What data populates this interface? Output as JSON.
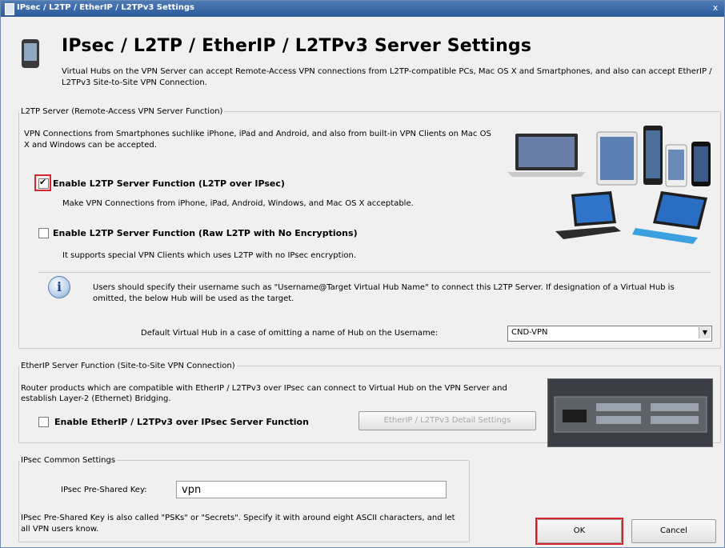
{
  "window": {
    "title": "IPsec / L2TP / EtherIP / L2TPv3 Settings",
    "close_glyph": "x"
  },
  "header": {
    "title": "IPsec / L2TP / EtherIP / L2TPv3 Server Settings",
    "description": "Virtual Hubs on the VPN Server can accept Remote-Access VPN connections from L2TP-compatible PCs, Mac OS X and Smartphones, and also can accept EtherIP / L2TPv3 Site-to-Site VPN Connection."
  },
  "l2tp": {
    "legend": "L2TP Server (Remote-Access VPN Server Function)",
    "intro": "VPN Connections from Smartphones suchlike iPhone, iPad and Android, and also from built-in VPN Clients on Mac OS X and Windows can be accepted.",
    "opt_ipsec": {
      "label": "Enable L2TP Server Function (L2TP over IPsec)",
      "checked": true,
      "description": "Make VPN Connections from iPhone, iPad, Android, Windows, and Mac OS X acceptable."
    },
    "opt_raw": {
      "label": "Enable L2TP Server Function (Raw L2TP with No Encryptions)",
      "checked": false,
      "description": "It supports special VPN Clients which uses L2TP with no IPsec encryption."
    },
    "info": "Users should specify their username such as \"Username@Target Virtual Hub Name\" to connect this L2TP Server. If designation of a Virtual Hub is omitted, the below Hub will be used as the target.",
    "default_hub_label": "Default Virtual Hub in a case of omitting a name of Hub on the Username:",
    "default_hub_value": "CND-VPN"
  },
  "etherip": {
    "legend": "EtherIP Server Function (Site-to-Site VPN Connection)",
    "description": "Router products which are compatible with EtherIP / L2TPv3 over IPsec can connect to Virtual Hub on the VPN Server and establish Layer-2 (Ethernet) Bridging.",
    "checkbox_label": "Enable EtherIP / L2TPv3 over IPsec Server Function",
    "checked": false,
    "detail_button": "EtherIP / L2TPv3 Detail Settings"
  },
  "ipsec": {
    "legend": "IPsec Common Settings",
    "psk_label": "IPsec Pre-Shared Key:",
    "psk_value": "vpn",
    "note": "IPsec Pre-Shared Key is also called \"PSKs\" or \"Secrets\". Specify it with around eight ASCII characters, and let all VPN users know."
  },
  "buttons": {
    "ok": "OK",
    "cancel": "Cancel"
  },
  "colors": {
    "highlight": "#d9252d",
    "titlebar": "#2b5a9b"
  }
}
